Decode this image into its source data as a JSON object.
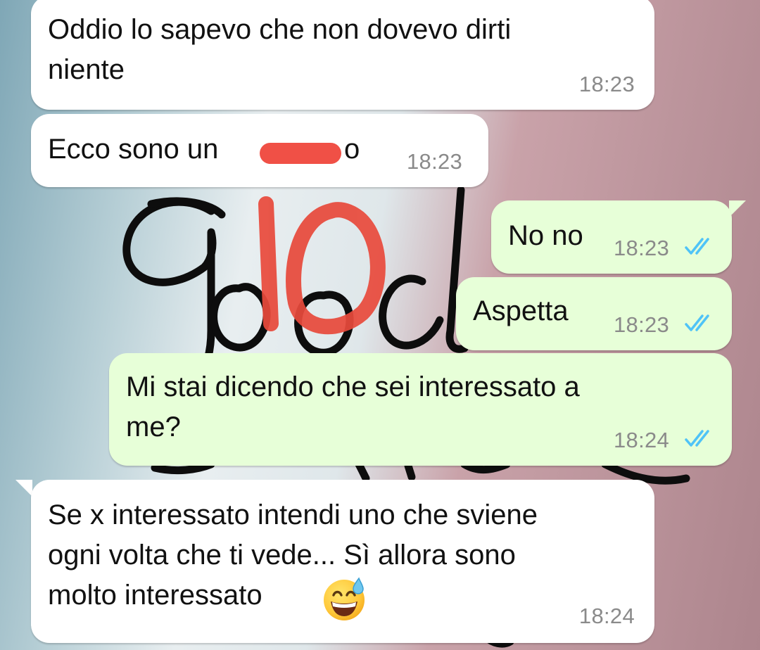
{
  "chat": {
    "messages": [
      {
        "direction": "incoming",
        "text": "Oddio lo sapevo che non dovevo dirti\nniente",
        "time": "18:23"
      },
      {
        "direction": "incoming",
        "text_before": "Ecco sono un",
        "text_after": "o",
        "time": "18:23",
        "redacted": true
      },
      {
        "direction": "outgoing",
        "text": "No no",
        "time": "18:23",
        "status": "read"
      },
      {
        "direction": "outgoing",
        "text": "Aspetta",
        "time": "18:23",
        "status": "read"
      },
      {
        "direction": "outgoing",
        "text": "Mi stai dicendo che sei interessato a\nme?",
        "time": "18:24",
        "status": "read"
      },
      {
        "direction": "incoming",
        "text": "Se x interessato intendi uno che sviene\nogni volta che ti vede... Sì allora sono\nmolto interessato",
        "emoji": "grinning-sweat-emoji",
        "time": "18:24"
      }
    ]
  },
  "annotation": {
    "drawn_text": "10"
  },
  "colors": {
    "incoming_bubble": "#ffffff",
    "outgoing_bubble": "#e7ffd8",
    "read_ticks": "#4fc3f7",
    "timestamp": "#8a8a8a",
    "redaction": "#f05046"
  }
}
